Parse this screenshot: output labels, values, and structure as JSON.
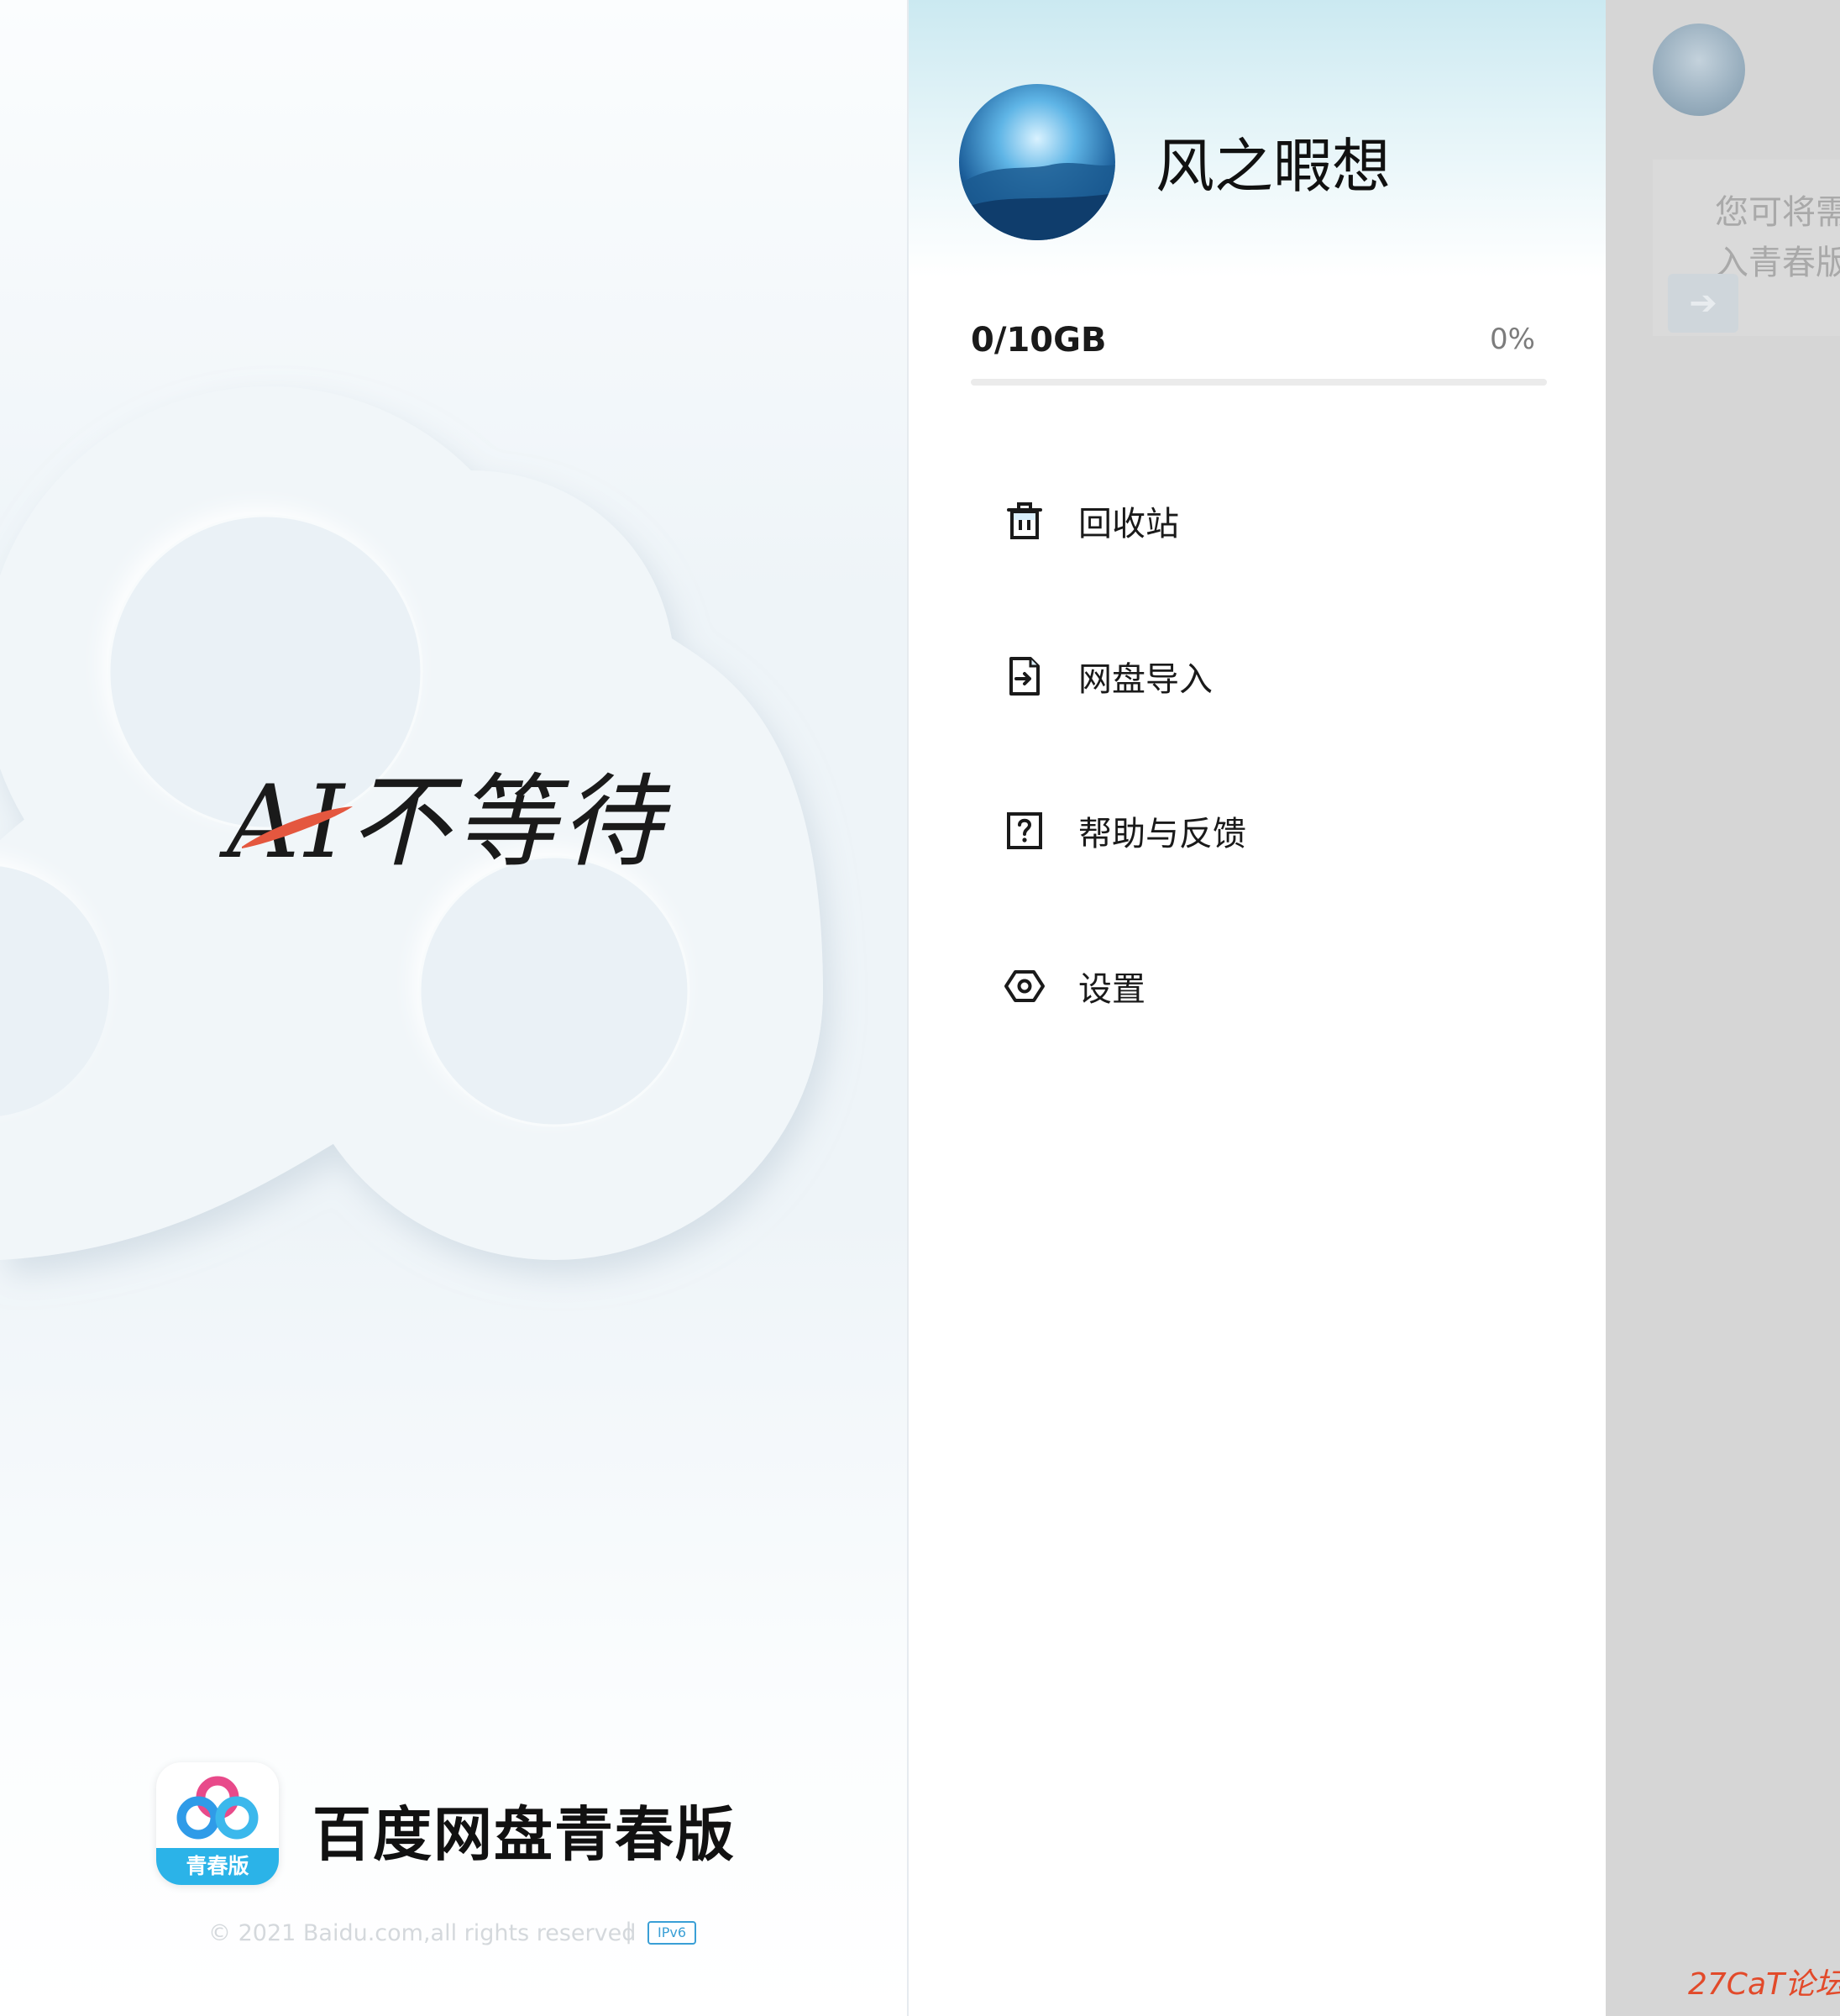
{
  "splash": {
    "slogan": "AI不等待",
    "brand_name": "百度网盘青春版",
    "brand_badge": "青春版",
    "copyright": "© 2021 Baidu.com,all rights reserved",
    "separator": "|",
    "ipv6_badge": "IPv6"
  },
  "drawer": {
    "username": "风之暇想",
    "quota": {
      "used_label": "0/10GB",
      "percent_label": "0%",
      "used_fraction": 0
    },
    "menu": [
      {
        "label": "回收站",
        "icon": "trash-icon"
      },
      {
        "label": "网盘导入",
        "icon": "file-import-icon"
      },
      {
        "label": "帮助与反馈",
        "icon": "help-icon"
      },
      {
        "label": "设置",
        "icon": "settings-hexagon-icon"
      }
    ]
  },
  "background_page": {
    "line1": "您可将需",
    "line2": "入青春版"
  },
  "watermark": "27CaT论坛",
  "colors": {
    "brand_blue": "#2bb3e8",
    "progress_blue": "#2b8ef0",
    "slogan_red": "#e4573f",
    "dim_overlay": "#d6d6d6"
  }
}
